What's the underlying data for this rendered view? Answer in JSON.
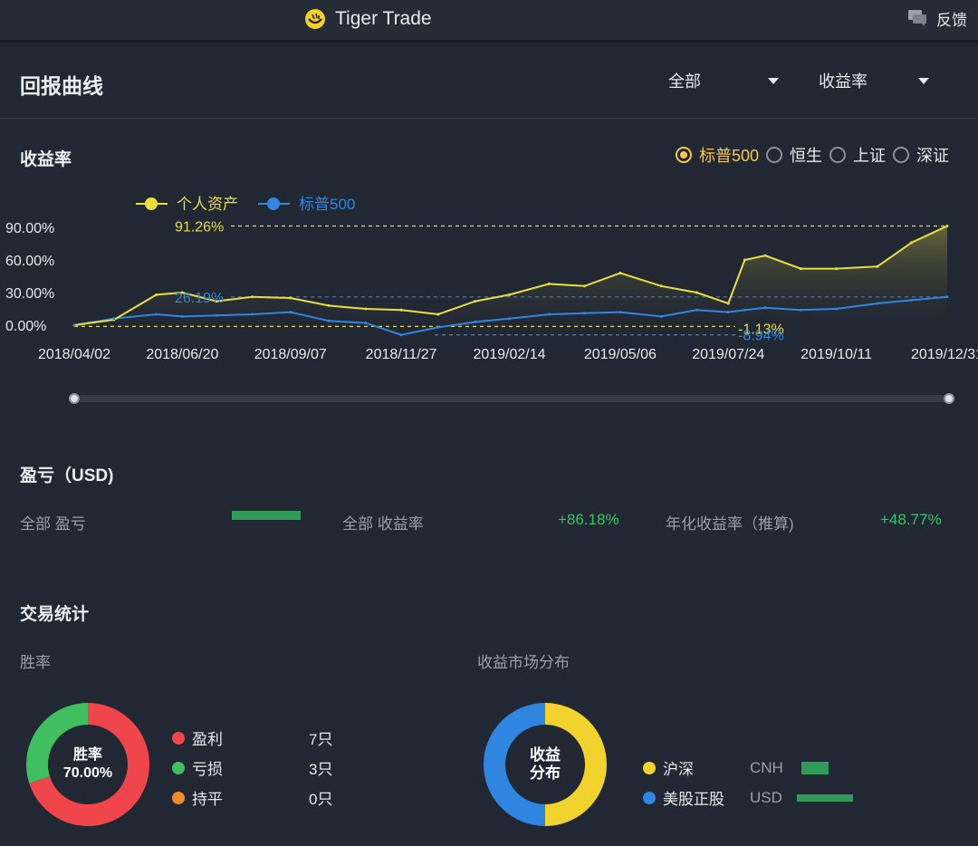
{
  "app": {
    "title": "Tiger Trade",
    "feedback_label": "反馈"
  },
  "header": {
    "title": "回报曲线",
    "filter_scope": "全部",
    "filter_metric": "收益率"
  },
  "returns": {
    "title": "收益率",
    "benchmarks": [
      {
        "label": "标普500",
        "selected": true
      },
      {
        "label": "恒生",
        "selected": false
      },
      {
        "label": "上证",
        "selected": false
      },
      {
        "label": "深证",
        "selected": false
      }
    ]
  },
  "chart_data": {
    "type": "line",
    "x": [
      "2018/04/02",
      "2018/05/01",
      "2018/06/01",
      "2018/06/20",
      "2018/07/15",
      "2018/08/10",
      "2018/09/07",
      "2018/10/05",
      "2018/11/01",
      "2018/11/27",
      "2018/12/24",
      "2019/01/20",
      "2019/02/14",
      "2019/03/15",
      "2019/04/10",
      "2019/05/06",
      "2019/06/05",
      "2019/07/01",
      "2019/07/24",
      "2019/08/05",
      "2019/08/20",
      "2019/09/15",
      "2019/10/11",
      "2019/11/10",
      "2019/12/05",
      "2019/12/31"
    ],
    "categories": [
      "2018/04/02",
      "2018/06/20",
      "2018/09/07",
      "2018/11/27",
      "2019/02/14",
      "2019/05/06",
      "2019/07/24",
      "2019/10/11",
      "2019/12/31"
    ],
    "series": [
      {
        "name": "个人资产",
        "color": "#e9df3c",
        "values": [
          0,
          5,
          28,
          30,
          22,
          26,
          25,
          18,
          15,
          14,
          10,
          22,
          28,
          38,
          36,
          48,
          36,
          30,
          20,
          60,
          64,
          52,
          52,
          54,
          76,
          91.26
        ]
      },
      {
        "name": "标普500",
        "color": "#2f86e0",
        "values": [
          0,
          6,
          10,
          8,
          9,
          10,
          12,
          4,
          2,
          -8.94,
          -2,
          3,
          6,
          10,
          11,
          12,
          8,
          14,
          12,
          14,
          16,
          14,
          15,
          20,
          23,
          26
        ]
      }
    ],
    "annotations": [
      "91.26%",
      "26.19%",
      "-1.13%",
      "-8.94%"
    ],
    "y_ticks": [
      "90.00%",
      "60.00%",
      "30.00%",
      "0.00%"
    ],
    "ylim": [
      -10,
      95
    ],
    "legend": "top-left"
  },
  "pnl": {
    "title": "盈亏（USD)",
    "total_pnl_label": "全部 盈亏",
    "total_return_label": "全部 收益率",
    "total_return_value": "+86.18%",
    "annualized_label": "年化收益率（推算)",
    "annualized_value": "+48.77%"
  },
  "trade_stats": {
    "title": "交易统计",
    "win_rate_title": "胜率",
    "win_rate_center_line1": "胜率",
    "win_rate_center_line2": "70.00%",
    "win_rate_items": [
      {
        "label": "盈利",
        "count": "7只",
        "color": "#f0454a",
        "share": 70
      },
      {
        "label": "亏损",
        "count": "3只",
        "color": "#3fbf5f",
        "share": 30
      },
      {
        "label": "持平",
        "count": "0只",
        "color": "#f08c2e",
        "share": 0
      }
    ],
    "market_title": "收益市场分布",
    "market_center_line1": "收益",
    "market_center_line2": "分布",
    "market_items": [
      {
        "label": "沪深",
        "currency": "CNH",
        "color": "#f2d32d",
        "share": 50
      },
      {
        "label": "美股正股",
        "currency": "USD",
        "color": "#2f86e0",
        "share": 50
      }
    ]
  }
}
